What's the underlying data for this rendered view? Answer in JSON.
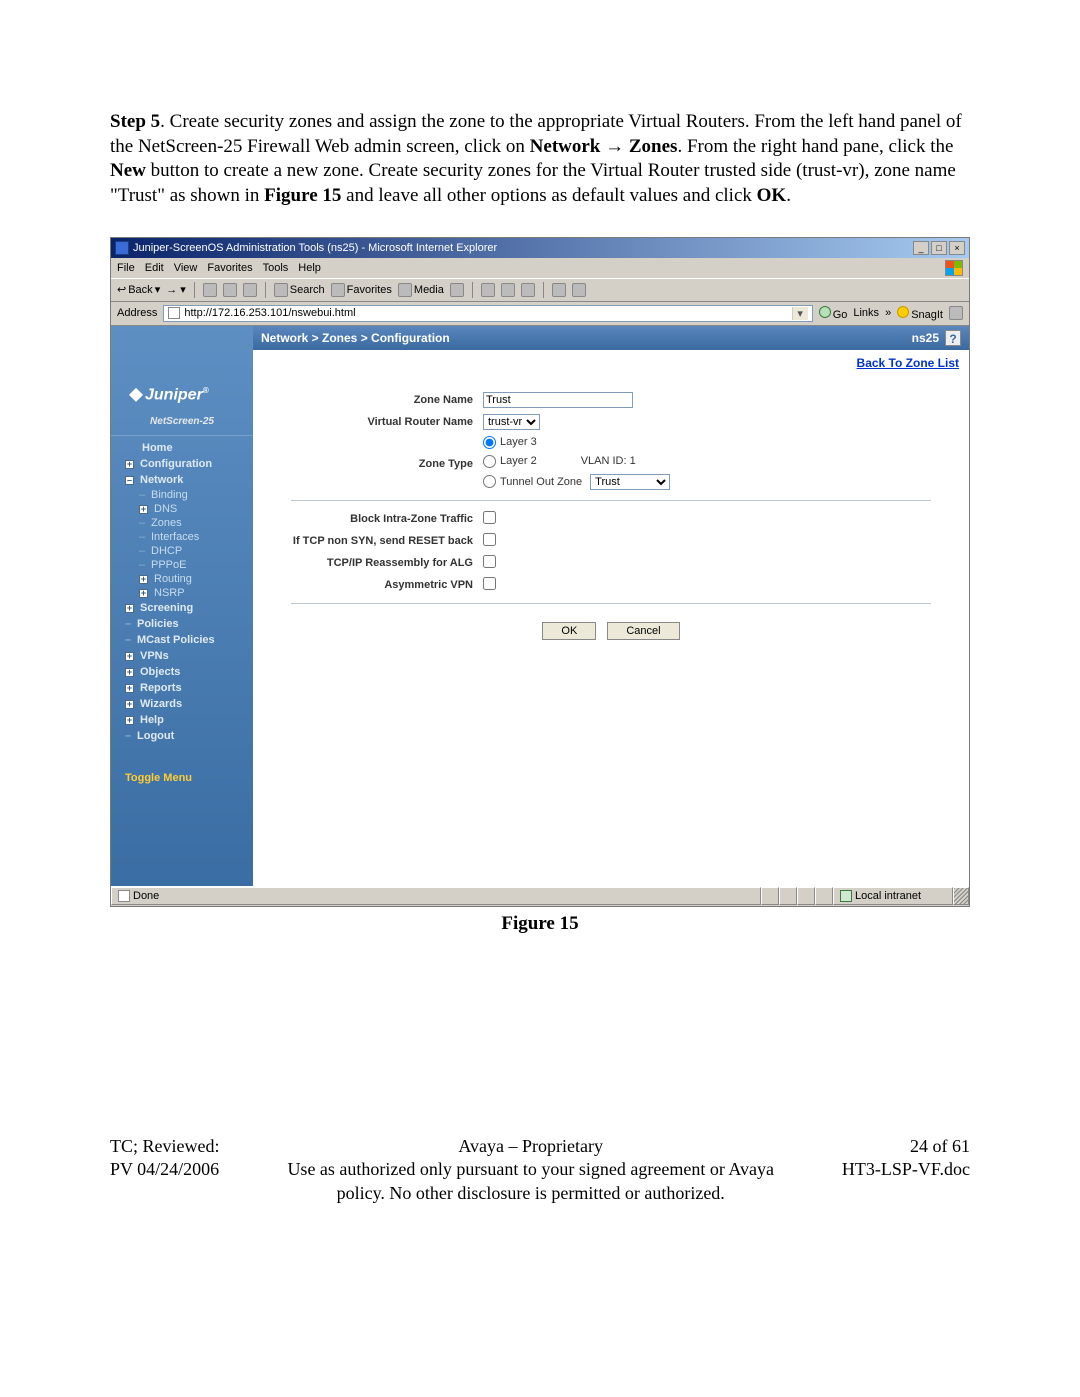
{
  "step": {
    "label": "Step 5",
    "text1": ". Create security zones and assign the zone to the appropriate Virtual Routers. From the left hand panel of the NetScreen-25 Firewall Web admin screen, click on ",
    "bold1": "Network",
    "arrow": " → ",
    "bold2": "Zones",
    "text2": ". From the right hand pane, click the ",
    "bold3": "New",
    "text3": " button to create a new zone. Create security zones for the Virtual Router trusted side (trust-vr), zone name \"Trust\" as shown in ",
    "bold4": "Figure 15",
    "text4": " and leave all other options as default values and click ",
    "bold5": "OK",
    "text5": "."
  },
  "window": {
    "title": "Juniper-ScreenOS Administration Tools (ns25) - Microsoft Internet Explorer",
    "menus": {
      "file": "File",
      "edit": "Edit",
      "view": "View",
      "favorites": "Favorites",
      "tools": "Tools",
      "help": "Help"
    },
    "toolbar": {
      "back": "Back",
      "search": "Search",
      "favorites": "Favorites",
      "media": "Media"
    },
    "address": {
      "label": "Address",
      "url": "http://172.16.253.101/nswebui.html",
      "go": "Go",
      "links": "Links",
      "snagit": "SnagIt"
    }
  },
  "breadcrumb": {
    "path": "Network > Zones > Configuration",
    "device": "ns25"
  },
  "backlink": "Back To Zone List",
  "sidebar": {
    "logo_text": "Juniper",
    "device": "NetScreen-25",
    "items": {
      "home": "Home",
      "configuration": "Configuration",
      "network": "Network",
      "binding": "Binding",
      "dns": "DNS",
      "zones": "Zones",
      "interfaces": "Interfaces",
      "dhcp": "DHCP",
      "pppoe": "PPPoE",
      "routing": "Routing",
      "nsrp": "NSRP",
      "screening": "Screening",
      "policies": "Policies",
      "mcast": "MCast Policies",
      "vpns": "VPNs",
      "objects": "Objects",
      "reports": "Reports",
      "wizards": "Wizards",
      "help": "Help",
      "logout": "Logout"
    },
    "toggle": "Toggle Menu"
  },
  "form": {
    "zone_name_label": "Zone Name",
    "zone_name_value": "Trust",
    "vr_label": "Virtual Router Name",
    "vr_value": "trust-vr",
    "zone_type_label": "Zone Type",
    "layer3": "Layer 3",
    "layer2": "Layer 2",
    "vlan_label": "VLAN ID: 1",
    "tunnel_out": "Tunnel Out Zone",
    "tunnel_value": "Trust",
    "block_intra": "Block Intra-Zone Traffic",
    "tcp_reset": "If TCP non SYN, send RESET back",
    "tcp_reasm": "TCP/IP Reassembly for ALG",
    "asym_vpn": "Asymmetric VPN",
    "ok": "OK",
    "cancel": "Cancel"
  },
  "status": {
    "done": "Done",
    "zone": "Local intranet"
  },
  "figure": "Figure 15",
  "footer": {
    "left1": "TC; Reviewed:",
    "left2": "PV 04/24/2006",
    "mid1": "Avaya – Proprietary",
    "mid2": "Use as authorized only pursuant to your signed agreement or Avaya policy. No other disclosure is permitted or authorized.",
    "right1": "24 of 61",
    "right2": "HT3-LSP-VF.doc"
  }
}
